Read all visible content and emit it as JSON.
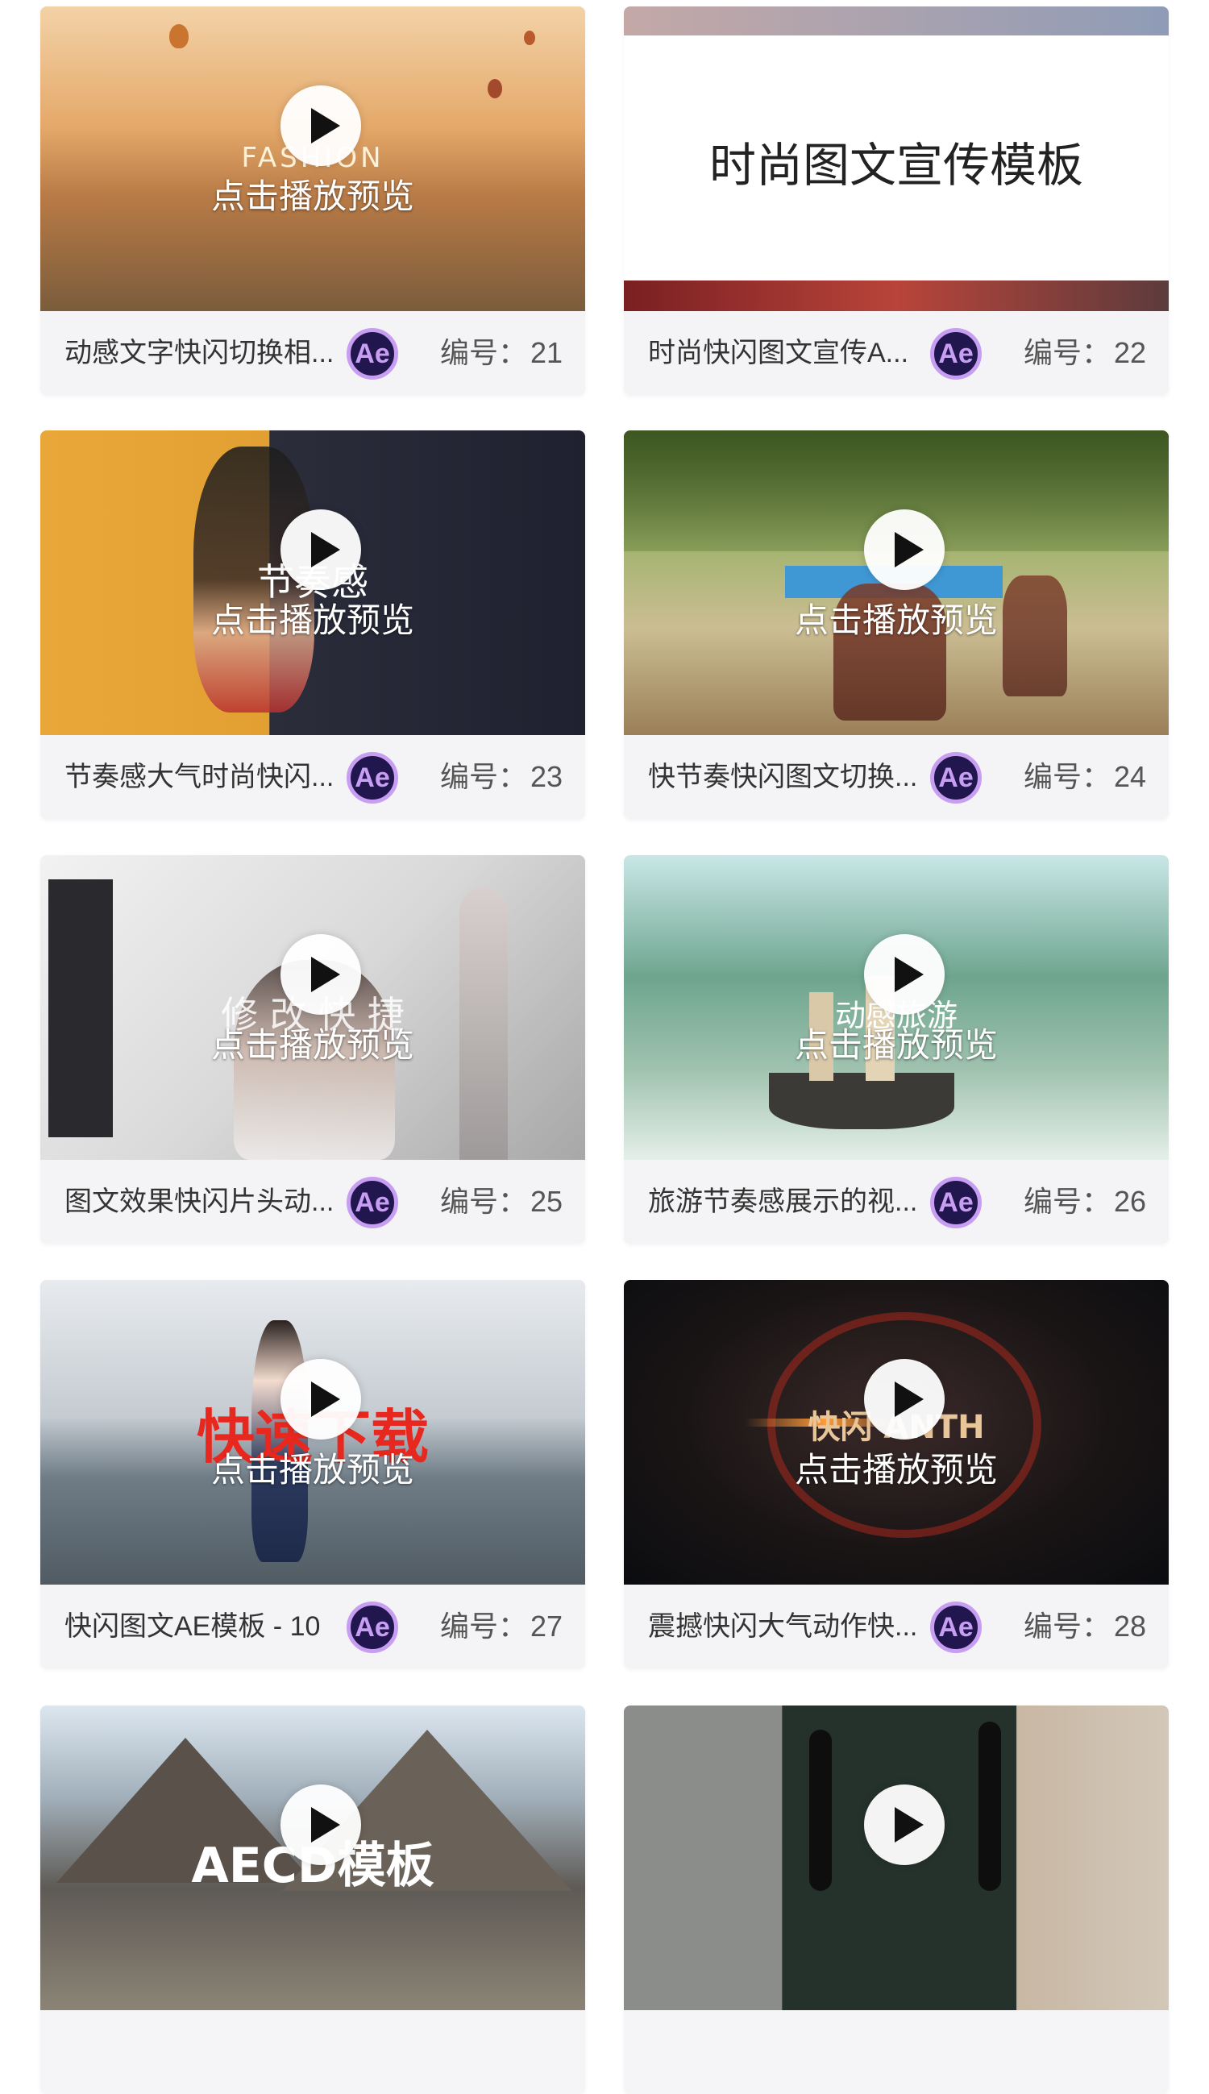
{
  "preview_label": "点击播放预览",
  "badge_label": "Ae",
  "code_prefix": "编号：",
  "cards": [
    {
      "title": "动感文字快闪切换相...",
      "number": "21",
      "overlay": "FASHION"
    },
    {
      "title": "时尚快闪图文宣传A...",
      "number": "22",
      "overlay": "时尚图文宣传模板"
    },
    {
      "title": "节奏感大气时尚快闪...",
      "number": "23",
      "overlay": "节奏感"
    },
    {
      "title": "快节奏快闪图文切换...",
      "number": "24",
      "overlay": ""
    },
    {
      "title": "图文效果快闪片头动...",
      "number": "25",
      "overlay": "修 改 快 捷"
    },
    {
      "title": "旅游节奏感展示的视...",
      "number": "26",
      "overlay": "动感旅游"
    },
    {
      "title": "快闪图文AE模板 - 10",
      "number": "27",
      "overlay": "快速下载"
    },
    {
      "title": "震撼快闪大气动作快...",
      "number": "28",
      "overlay": "快闪 ANTH"
    },
    {
      "title": "",
      "number": "",
      "overlay": "AECD模板"
    },
    {
      "title": "",
      "number": "",
      "overlay": ""
    }
  ],
  "colors": {
    "card_bg": "#f4f4f6",
    "ae_badge_bg": "#22164f",
    "ae_badge_accent": "#c79ef2",
    "overlay_red": "#e8281e",
    "overlay_blue": "#3f97d3"
  }
}
